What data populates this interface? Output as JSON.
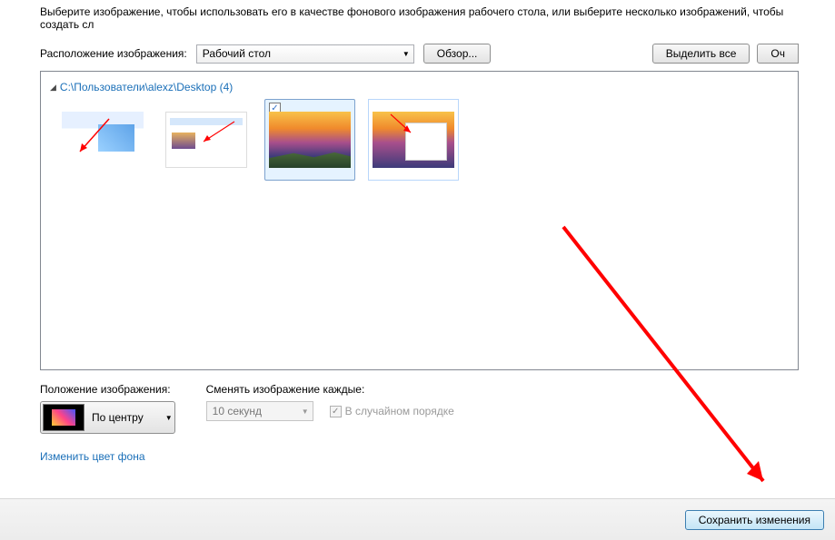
{
  "description": "Выберите изображение, чтобы использовать его в качестве фонового изображения рабочего стола, или выберите несколько изображений, чтобы создать сл",
  "location": {
    "label": "Расположение изображения:",
    "value": "Рабочий стол"
  },
  "buttons": {
    "browse": "Обзор...",
    "select_all": "Выделить все",
    "clear": "Оч",
    "save": "Сохранить изменения"
  },
  "gallery": {
    "path": "C:\\Пользователи\\alexz\\Desktop (4)",
    "items_count": 4,
    "selected_index": 2
  },
  "position": {
    "label": "Положение изображения:",
    "value": "По центру"
  },
  "interval": {
    "label": "Сменять изображение каждые:",
    "value": "10 секунд"
  },
  "shuffle": {
    "label": "В случайном порядке",
    "checked": true,
    "enabled": false
  },
  "links": {
    "change_bg_color": "Изменить цвет фона"
  }
}
